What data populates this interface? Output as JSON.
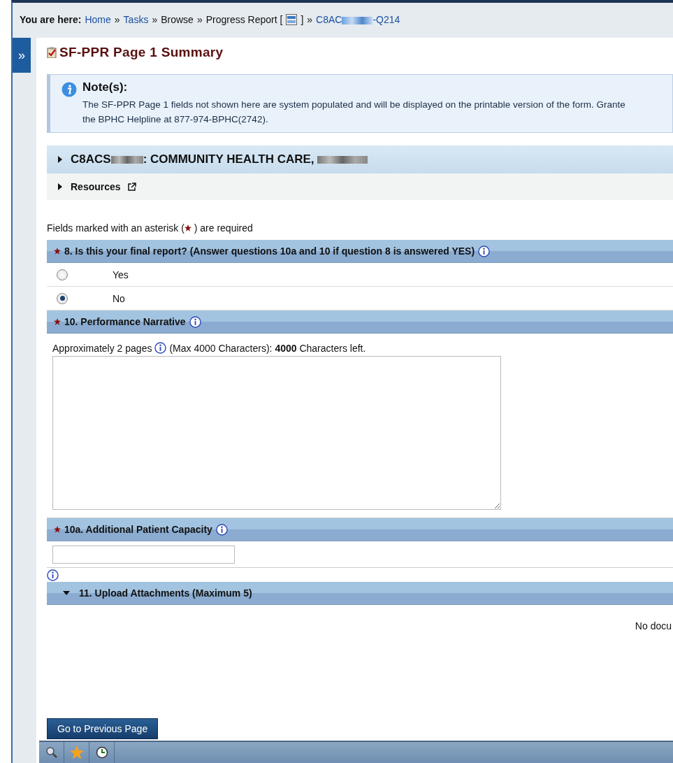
{
  "breadcrumb": {
    "label": "You are here:",
    "items": [
      {
        "text": "Home",
        "kind": "link"
      },
      {
        "sep": "»",
        "text": "Tasks",
        "kind": "link"
      },
      {
        "sep": "»",
        "text": "Browse",
        "kind": "text"
      },
      {
        "sep": "»",
        "text": "Progress Report [",
        "kind": "text"
      },
      {
        "kind": "icon"
      },
      {
        "text": "]",
        "kind": "text"
      },
      {
        "sep": "»",
        "text": "C8AC",
        "after": "-Q214",
        "kind": "redacted-link"
      }
    ]
  },
  "sidebar_toggle": "»",
  "page_title": "SF-PPR Page 1 Summary",
  "note": {
    "title": "Note(s):",
    "lines": [
      "The SF-PPR Page 1 fields not shown here are system populated and will be displayed on the printable version of the form. Grante",
      "the BPHC Helpline at 877-974-BPHC(2742)."
    ]
  },
  "panels": [
    {
      "kind": "org",
      "before": "C8ACS",
      "middle": ": COMMUNITY HEALTH CARE, ",
      "expanded": false
    },
    {
      "kind": "resources",
      "label": "Resources",
      "expanded": false
    }
  ],
  "required_hint": {
    "before": "Fields marked with an asterisk (",
    "after": " ) are required"
  },
  "question_8": {
    "label": "8. Is this your final report? (Answer questions 10a and 10 if question 8 is answered YES)",
    "required": true,
    "options": [
      {
        "label": "Yes",
        "selected": false
      },
      {
        "label": "No",
        "selected": true
      }
    ]
  },
  "question_10": {
    "label": "10. Performance Narrative",
    "required": true,
    "hint_before": "Approximately 2 pages",
    "hint_after": "(Max 4000 Characters):",
    "count": "4000",
    "count_after": "Characters left."
  },
  "question_10a": {
    "label": "10a. Additional Patient Capacity",
    "required": true
  },
  "question_11": {
    "label": "11. Upload Attachments (Maximum 5)",
    "expanded": true,
    "empty_text": "No docu"
  },
  "button": "Go to Previous Page"
}
